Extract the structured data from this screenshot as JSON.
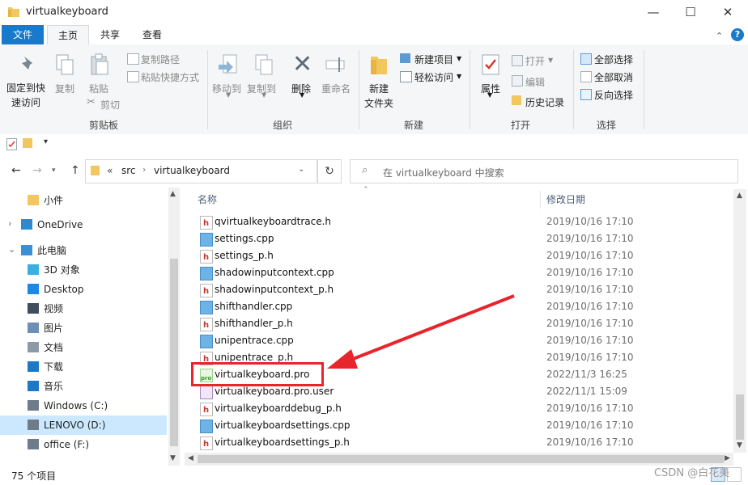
{
  "window": {
    "title": "virtualkeyboard",
    "minimize": "—",
    "maximize": "☐",
    "close": "✕"
  },
  "ribbon_tabs": [
    {
      "label": "文件"
    },
    {
      "label": "主页"
    },
    {
      "label": "共享"
    },
    {
      "label": "查看"
    }
  ],
  "ribbon": {
    "clipboard": {
      "pin_label_1": "固定到快",
      "pin_label_2": "速访问",
      "copy": "复制",
      "paste": "粘贴",
      "copy_path": "复制路径",
      "paste_shortcut": "粘贴快捷方式",
      "cut": "剪切",
      "group": "剪贴板"
    },
    "organize": {
      "move_to": "移动到",
      "copy_to": "复制到",
      "delete": "删除",
      "rename": "重命名",
      "group": "组织"
    },
    "new": {
      "new_folder_1": "新建",
      "new_folder_2": "文件夹",
      "new_item": "新建项目",
      "easy_access": "轻松访问",
      "group": "新建"
    },
    "open": {
      "properties": "属性",
      "open": "打开",
      "edit": "编辑",
      "history": "历史记录",
      "group": "打开"
    },
    "select": {
      "select_all": "全部选择",
      "select_none": "全部取消",
      "invert": "反向选择",
      "group": "选择"
    }
  },
  "address": {
    "crumbs": [
      "«",
      "src",
      "virtualkeyboard"
    ],
    "search_placeholder": "在 virtualkeyboard 中搜索"
  },
  "nav": [
    {
      "label": "小件",
      "icon": "folder-icon",
      "color": "#f3c75f"
    },
    {
      "label": "OneDrive",
      "icon": "cloud-icon",
      "color": "#2a8ad4"
    },
    {
      "label": "此电脑",
      "icon": "pc-icon",
      "color": "#3a8fd6"
    },
    {
      "label": "3D 对象",
      "icon": "cube-icon",
      "color": "#3ab0e0"
    },
    {
      "label": "Desktop",
      "icon": "desktop-icon",
      "color": "#1e88e5"
    },
    {
      "label": "视频",
      "icon": "video-icon",
      "color": "#3f4d5c"
    },
    {
      "label": "图片",
      "icon": "picture-icon",
      "color": "#6c8fb3"
    },
    {
      "label": "文档",
      "icon": "document-icon",
      "color": "#8c9aa8"
    },
    {
      "label": "下载",
      "icon": "download-icon",
      "color": "#1e78c8"
    },
    {
      "label": "音乐",
      "icon": "music-icon",
      "color": "#1e78c8"
    },
    {
      "label": "Windows (C:)",
      "icon": "drive-icon",
      "color": "#6e7c8a"
    },
    {
      "label": "LENOVO (D:)",
      "icon": "drive-icon",
      "color": "#6e7c8a"
    },
    {
      "label": "office (F:)",
      "icon": "drive-icon",
      "color": "#6e7c8a"
    }
  ],
  "columns": {
    "name": "名称",
    "date": "修改日期"
  },
  "files": [
    {
      "name": "qvirtualkeyboardtrace.h",
      "date": "2019/10/16 17:10",
      "type": "h"
    },
    {
      "name": "settings.cpp",
      "date": "2019/10/16 17:10",
      "type": "cpp"
    },
    {
      "name": "settings_p.h",
      "date": "2019/10/16 17:10",
      "type": "h"
    },
    {
      "name": "shadowinputcontext.cpp",
      "date": "2019/10/16 17:10",
      "type": "cpp"
    },
    {
      "name": "shadowinputcontext_p.h",
      "date": "2019/10/16 17:10",
      "type": "h"
    },
    {
      "name": "shifthandler.cpp",
      "date": "2019/10/16 17:10",
      "type": "cpp"
    },
    {
      "name": "shifthandler_p.h",
      "date": "2019/10/16 17:10",
      "type": "h"
    },
    {
      "name": "unipentrace.cpp",
      "date": "2019/10/16 17:10",
      "type": "cpp"
    },
    {
      "name": "unipentrace_p.h",
      "date": "2019/10/16 17:10",
      "type": "h"
    },
    {
      "name": "virtualkeyboard.pro",
      "date": "2022/11/3 16:25",
      "type": "pro"
    },
    {
      "name": "virtualkeyboard.pro.user",
      "date": "2022/11/1 15:09",
      "type": "user"
    },
    {
      "name": "virtualkeyboarddebug_p.h",
      "date": "2019/10/16 17:10",
      "type": "h"
    },
    {
      "name": "virtualkeyboardsettings.cpp",
      "date": "2019/10/16 17:10",
      "type": "cpp"
    },
    {
      "name": "virtualkeyboardsettings_p.h",
      "date": "2019/10/16 17:10",
      "type": "h"
    }
  ],
  "status": {
    "count": "75 个项目"
  },
  "watermark": "CSDN @白花美",
  "colors": {
    "accent": "#1979ca",
    "highlight": "#e8242c",
    "selected": "#cce8ff"
  }
}
